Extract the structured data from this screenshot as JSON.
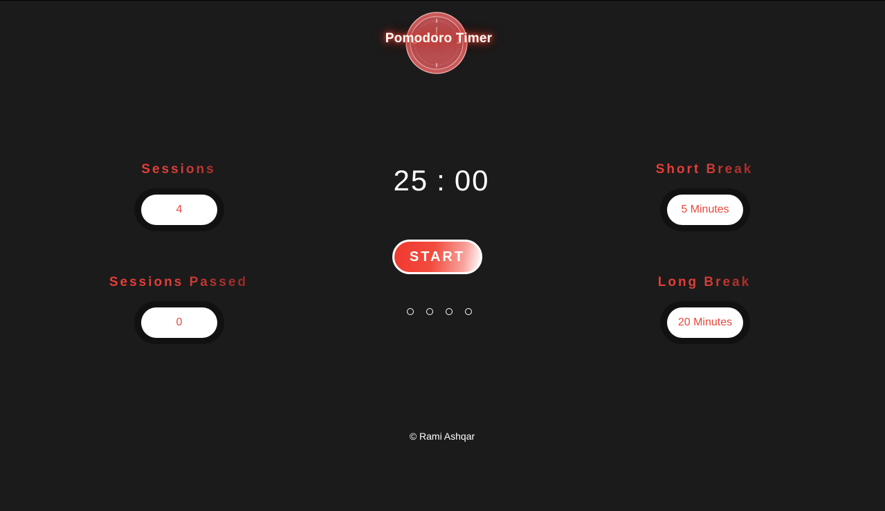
{
  "header": {
    "title": "Pomodoro Timer",
    "logo_icon": "stopwatch-icon"
  },
  "settings": {
    "sessions": {
      "label": "Sessions",
      "value": "4"
    },
    "sessions_passed": {
      "label": "Sessions Passed",
      "value": "0"
    },
    "short_break": {
      "label": "Short Break",
      "value": "5 Minutes"
    },
    "long_break": {
      "label": "Long Break",
      "value": "20 Minutes"
    }
  },
  "timer": {
    "minutes": "25",
    "separator": ":",
    "seconds": "00"
  },
  "controls": {
    "start_label": "START"
  },
  "session_dots": {
    "total": 4,
    "completed": 0,
    "icon": "session-dot-icon"
  },
  "footer": {
    "copyright": "© Rami Ashqar"
  },
  "colors": {
    "background": "#1b1b1b",
    "accent": "#e8473b",
    "pill": "#ffffff"
  }
}
